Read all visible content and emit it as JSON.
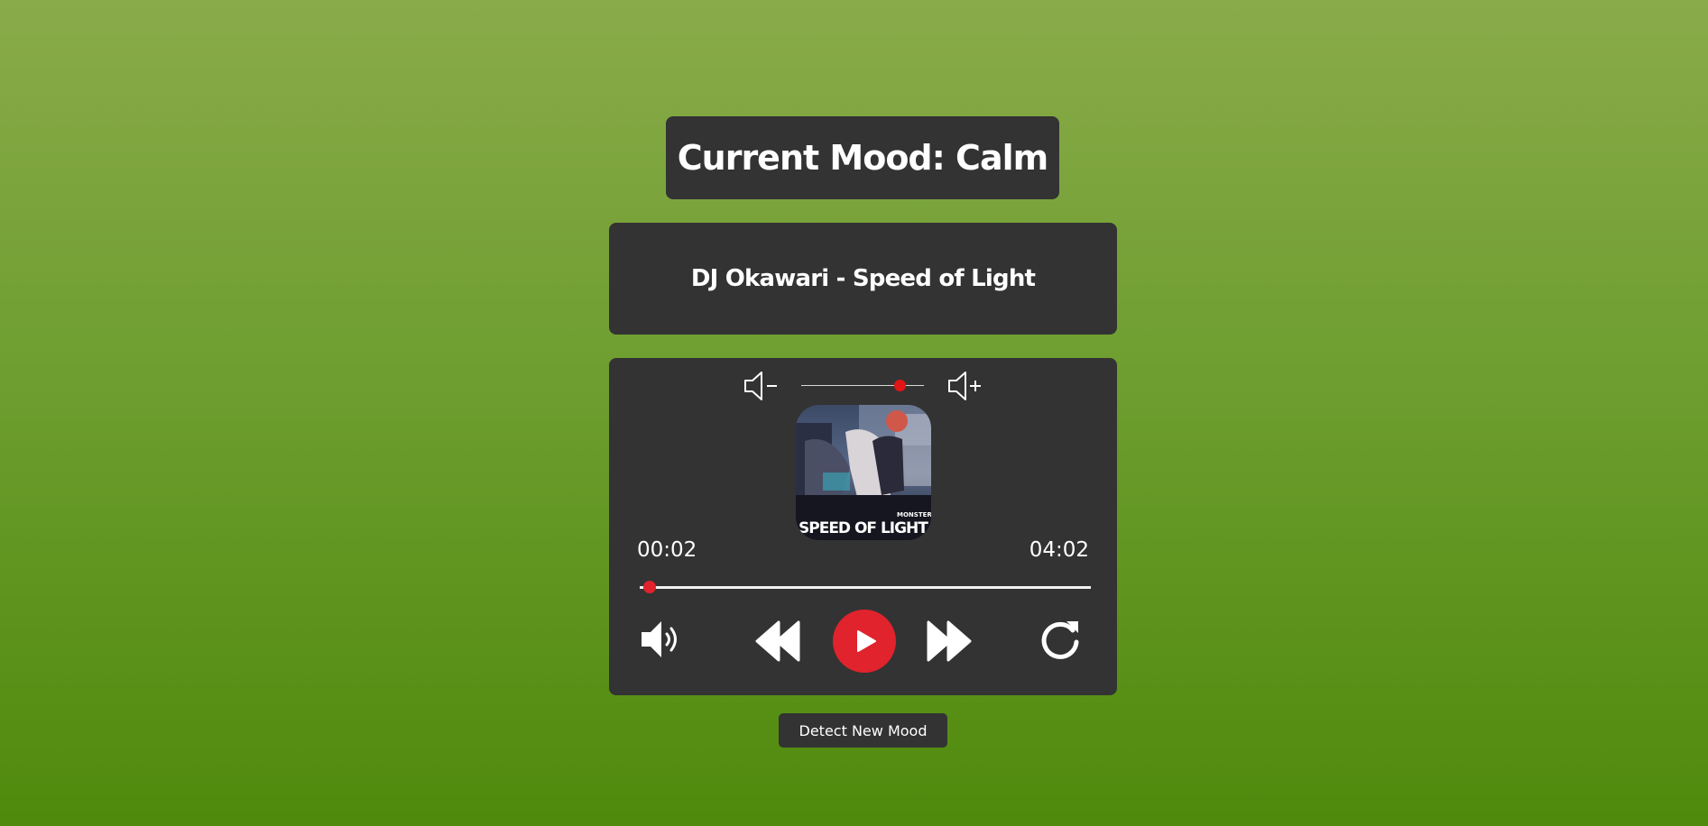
{
  "mood": {
    "title": "Current Mood: Calm"
  },
  "song": {
    "title": "DJ Okawari - Speed of Light"
  },
  "player": {
    "volume_level": 0.8,
    "current_time": "00:02",
    "total_time": "04:02",
    "progress": 0.008,
    "album_art": {
      "caption_top": "MONSTER SIREN",
      "caption_main": "SPEED OF LIGHT"
    },
    "icons": {
      "volume_down": "volume-down-icon",
      "volume_up": "volume-up-icon",
      "speaker": "speaker-icon",
      "rewind": "rewind-icon",
      "play": "play-icon",
      "fast_forward": "fast-forward-icon",
      "repeat": "repeat-icon"
    }
  },
  "actions": {
    "detect_label": "Detect New Mood"
  },
  "colors": {
    "panel": "#333333",
    "accent": "#e0232c",
    "background_top": "#8aab4a",
    "background_bottom": "#4f8a0c"
  }
}
